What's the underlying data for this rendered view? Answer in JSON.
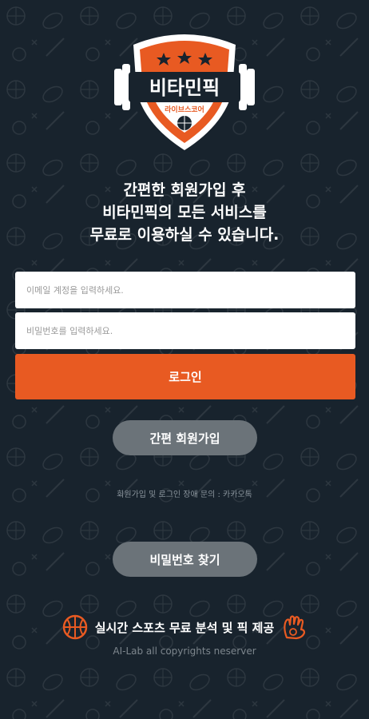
{
  "brand": {
    "name": "비타민픽",
    "sub": "라이브스코어",
    "primary_color": "#e85a22",
    "background_color": "#18232d"
  },
  "headline": {
    "line1": "간편한 회원가입 후",
    "line2": "비타민픽의 모든 서비스를",
    "line3": "무료로 이용하실 수 있습니다."
  },
  "form": {
    "email_placeholder": "이메일 계정을 입력하세요.",
    "password_placeholder": "비밀번호를 입력하세요.",
    "login_label": "로그인"
  },
  "signup_label": "간편 회원가입",
  "inquiry_text": "회원가입 및 로그인 장애 문의 : 카카오톡",
  "find_password_label": "비밀번호 찾기",
  "promo": {
    "text": "실시간 스포츠 무료 분석 및 픽 제공",
    "left_icon": "basketball-icon",
    "right_icon": "baseball-glove-icon"
  },
  "copyright": "AI-Lab all copyrights neserver"
}
